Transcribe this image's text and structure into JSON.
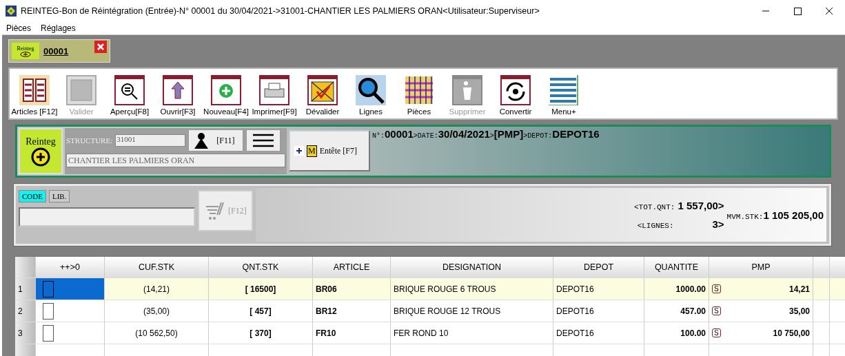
{
  "window": {
    "title": "REINTEG-Bon de Réintégration (Entrée)-N° 00001 du 30/04/2021->31001-CHANTIER LES PALMIERS ORAN<Utilisateur:Superviseur>"
  },
  "menu": [
    "Pièces",
    "Réglages"
  ],
  "doc_tab": {
    "icon_label": "Reinteg",
    "label": "00001"
  },
  "toolbar": [
    {
      "kind": "articles",
      "label": "Articles [F12]",
      "disabled": false
    },
    {
      "kind": "blank",
      "label": "Valider",
      "disabled": true
    },
    {
      "kind": "preview",
      "label": "Aperçu[F8]",
      "disabled": false
    },
    {
      "kind": "open",
      "label": "Ouvrir[F3]",
      "disabled": false
    },
    {
      "kind": "new",
      "label": "Nouveau[F4]",
      "disabled": false
    },
    {
      "kind": "print",
      "label": "Imprimer[F9]",
      "disabled": false
    },
    {
      "kind": "unvalidate",
      "label": "Dévalider",
      "disabled": false
    },
    {
      "kind": "search",
      "label": "Lignes",
      "disabled": false
    },
    {
      "kind": "grid",
      "label": "Pièces",
      "disabled": false
    },
    {
      "kind": "trash",
      "label": "Supprimer",
      "disabled": true
    },
    {
      "kind": "convert",
      "label": "Convertir",
      "disabled": false
    },
    {
      "kind": "menu",
      "label": "Menu+",
      "disabled": false
    }
  ],
  "header": {
    "badge": "Reinteg",
    "structure_label": "STRUCTURE:",
    "structure_code": "31001",
    "structure_name": "CHANTIER LES PALMIERS ORAN",
    "user_button": "[F11]",
    "entete_mark": "M",
    "entete_button": "Entête [F7]",
    "info": [
      {
        "label": "N°:",
        "value": "00001"
      },
      {
        "label": ">DATE:",
        "value": "30/04/2021"
      },
      {
        "label": ">",
        "value": "[PMP]"
      },
      {
        "label": ">DEPOT:",
        "value": "DEPOT16"
      }
    ]
  },
  "search": {
    "modes": [
      {
        "label": "CODE",
        "selected": true
      },
      {
        "label": "LIB.",
        "selected": false
      }
    ],
    "cart_button": "[F12]",
    "cart_disabled": true,
    "tot_qnt_label": "<TOT.QNT:",
    "tot_qnt": "1 557,00>",
    "lignes_label": "<LIGNES:",
    "lignes": "3>",
    "mvm_label": "MVM.STK:",
    "mvm": "1 105 205,00"
  },
  "grid": {
    "columns": [
      "++>0",
      "CUF.STK",
      "QNT.STK",
      "ARTICLE",
      "DESIGNATION",
      "DEPOT",
      "QUANTITE",
      "PMP"
    ],
    "rows": [
      {
        "num": "1",
        "selected": true,
        "cuf": "(14,21)",
        "qnt": "[ 16500]",
        "article": "BR06",
        "designation": "BRIQUE ROUGE 6 TROUS",
        "depot": "DEPOT16",
        "quantite": "1000.00",
        "flag": "S",
        "pmp": "14,21"
      },
      {
        "num": "2",
        "selected": false,
        "cuf": "(35,00)",
        "qnt": "[ 457]",
        "article": "BR12",
        "designation": "BRIQUE ROUGE 12 TROUS",
        "depot": "DEPOT16",
        "quantite": "457.00",
        "flag": "S",
        "pmp": "35,00"
      },
      {
        "num": "3",
        "selected": false,
        "cuf": "(10 562,50)",
        "qnt": "[ 370]",
        "article": "FR10",
        "designation": "FER ROND 10",
        "depot": "DEPOT16",
        "quantite": "100.00",
        "flag": "S",
        "pmp": "10 750,00"
      }
    ]
  }
}
